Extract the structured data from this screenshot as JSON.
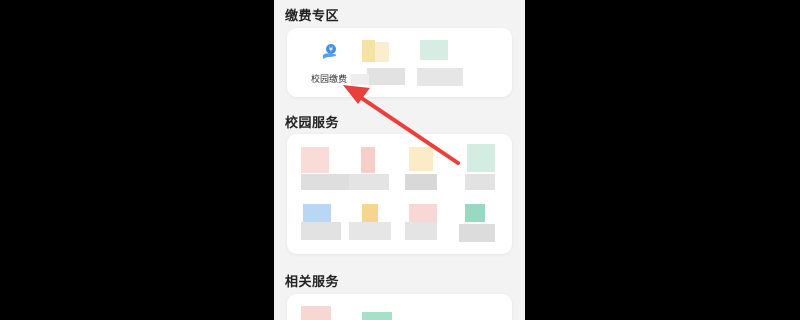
{
  "sections": {
    "payment": {
      "title": "缴费专区"
    },
    "campus": {
      "title": "校园服务"
    },
    "related": {
      "title": "相关服务"
    }
  },
  "payment_items": [
    {
      "label": "校园缴费",
      "icon": "hand-coin-icon",
      "color": "#3d8fe0"
    }
  ],
  "colors": {
    "background": "#000000",
    "page": "#f3f3f3",
    "card": "#ffffff",
    "arrow": "#e8403a"
  }
}
